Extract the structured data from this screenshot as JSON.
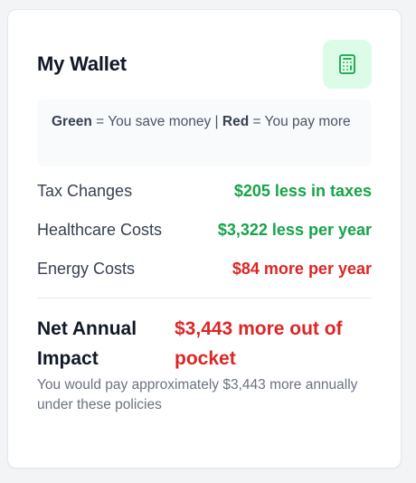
{
  "wallet": {
    "title": "My Wallet",
    "icon": "calculator-icon",
    "legend": {
      "green_word": "Green",
      "green_text": " = You save money | ",
      "red_word": "Red",
      "red_text": " = You pay more"
    },
    "rows": [
      {
        "label": "Tax Changes",
        "value": "$205 less in taxes",
        "status": "save"
      },
      {
        "label": "Healthcare Costs",
        "value": "$3,322 less per year",
        "status": "save"
      },
      {
        "label": "Energy Costs",
        "value": "$84 more per year",
        "status": "pay"
      }
    ],
    "net": {
      "label": "Net Annual Impact",
      "value": "$3,443 more out of pocket",
      "description": "You would pay approximately $3,443 more annually under these policies"
    }
  },
  "colors": {
    "save": "#16a34a",
    "pay": "#dc2626",
    "icon_bg": "#dcfce7",
    "icon_stroke": "#16a34a"
  }
}
